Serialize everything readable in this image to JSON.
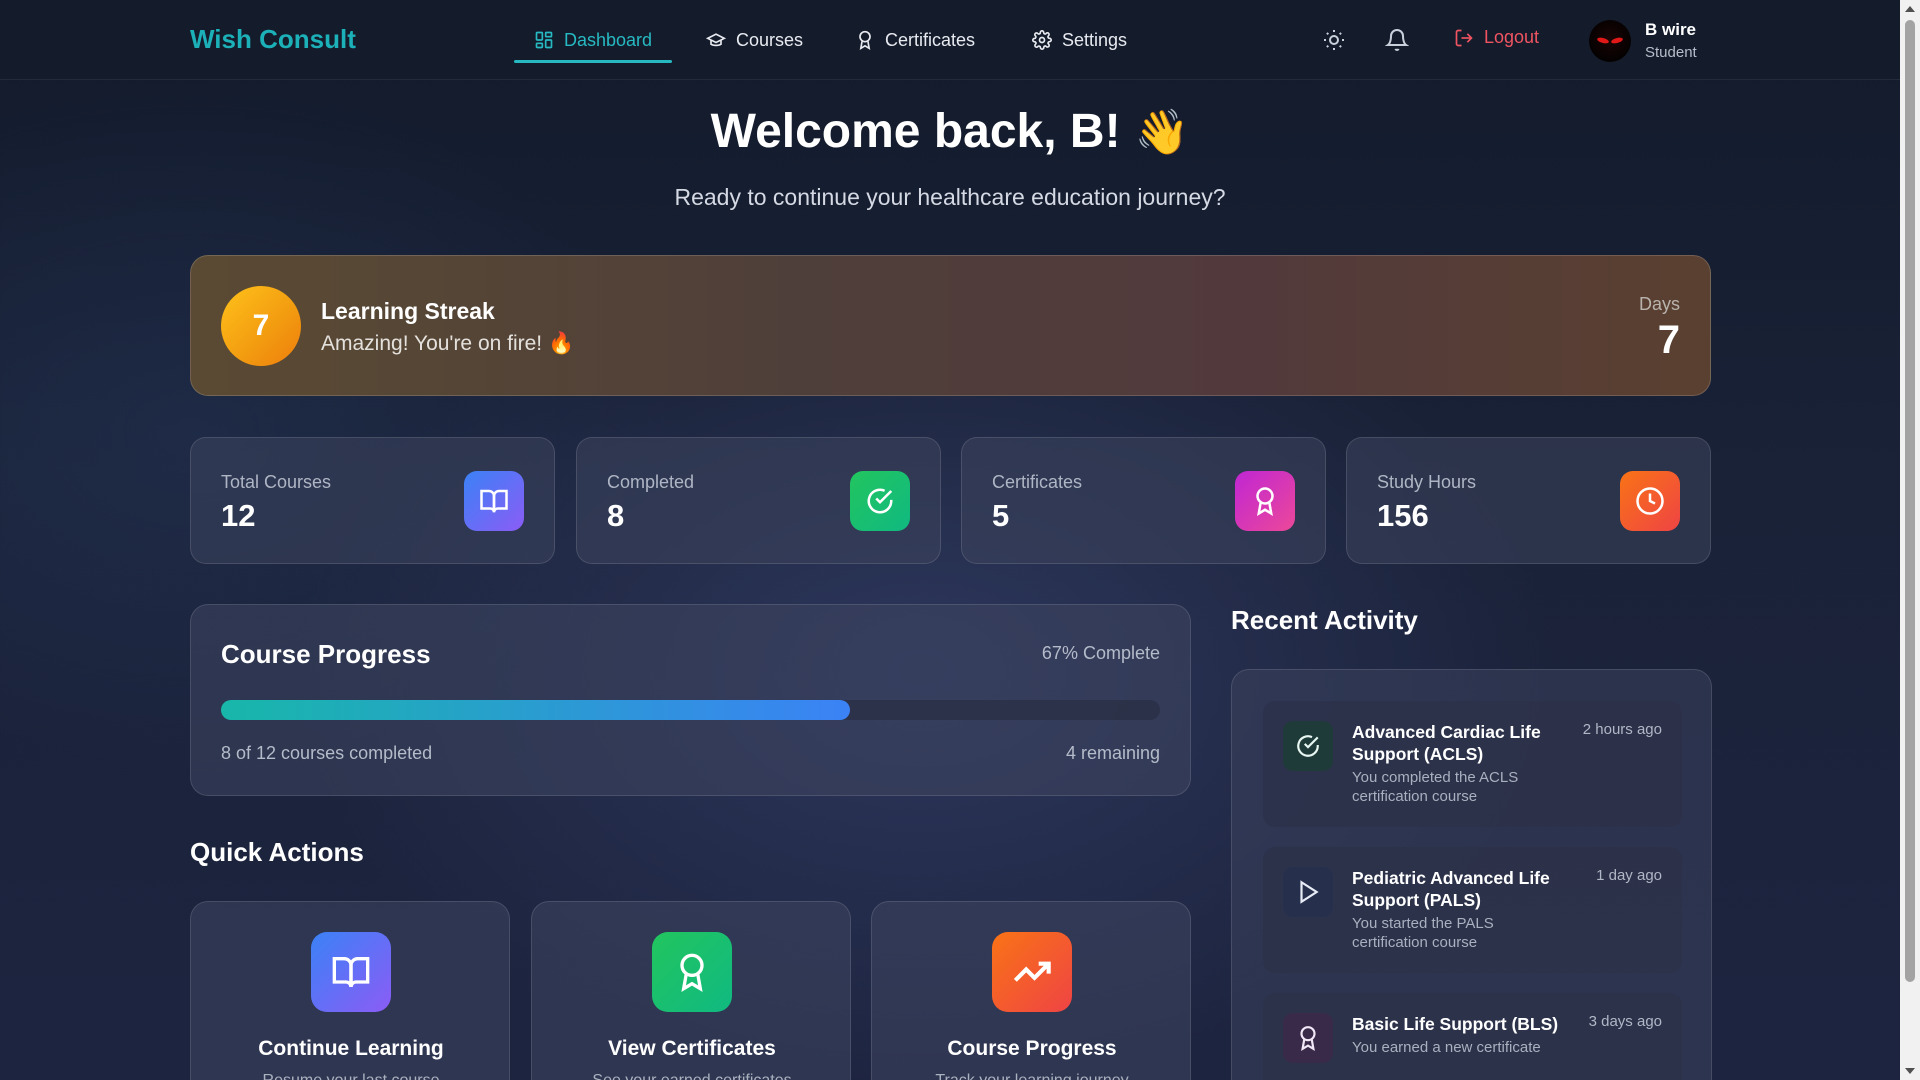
{
  "brand": "Wish Consult",
  "nav": {
    "items": [
      {
        "label": "Dashboard",
        "icon": "dashboard-grid-icon",
        "active": true
      },
      {
        "label": "Courses",
        "icon": "graduation-cap-icon"
      },
      {
        "label": "Certificates",
        "icon": "award-icon"
      },
      {
        "label": "Settings",
        "icon": "gear-icon"
      }
    ],
    "logout": "Logout"
  },
  "user": {
    "name": "B wire",
    "role": "Student"
  },
  "hero": {
    "welcome": "Welcome back, B!",
    "wave": "👋",
    "subtitle": "Ready to continue your healthcare education journey?"
  },
  "streak": {
    "badge": "7",
    "title": "Learning Streak",
    "subtitle": "Amazing! You're on fire! 🔥",
    "days_label": "Days",
    "days_value": "7"
  },
  "stats": [
    {
      "label": "Total Courses",
      "value": "12",
      "icon": "book-open-icon",
      "color": "#6366f1"
    },
    {
      "label": "Completed",
      "value": "8",
      "icon": "check-circle-icon",
      "color": "#10b981"
    },
    {
      "label": "Certificates",
      "value": "5",
      "icon": "award-icon",
      "color": "#d946ef"
    },
    {
      "label": "Study Hours",
      "value": "156",
      "icon": "clock-icon",
      "color": "#f97316"
    }
  ],
  "progress": {
    "title": "Course Progress",
    "complete_label": "67% Complete",
    "percent": 67,
    "completed_label": "8 of 12 courses completed",
    "remaining_label": "4 remaining"
  },
  "quick_actions": {
    "title": "Quick Actions",
    "items": [
      {
        "title": "Continue Learning",
        "subtitle": "Resume your last course",
        "icon": "book-open-icon"
      },
      {
        "title": "View Certificates",
        "subtitle": "See your earned certificates",
        "icon": "award-icon"
      },
      {
        "title": "Course Progress",
        "subtitle": "Track your learning journey",
        "icon": "trending-up-icon"
      }
    ]
  },
  "recent_activity": {
    "title": "Recent Activity",
    "items": [
      {
        "title": "Advanced Cardiac Life Support (ACLS)",
        "time": "2 hours ago",
        "description": "You completed the ACLS certification course",
        "icon": "check-circle-icon"
      },
      {
        "title": "Pediatric Advanced Life Support (PALS)",
        "time": "1 day ago",
        "description": "You started the PALS certification course",
        "icon": "play-icon"
      },
      {
        "title": "Basic Life Support (BLS)",
        "time": "3 days ago",
        "description": "You earned a new certificate",
        "icon": "award-icon"
      }
    ]
  }
}
